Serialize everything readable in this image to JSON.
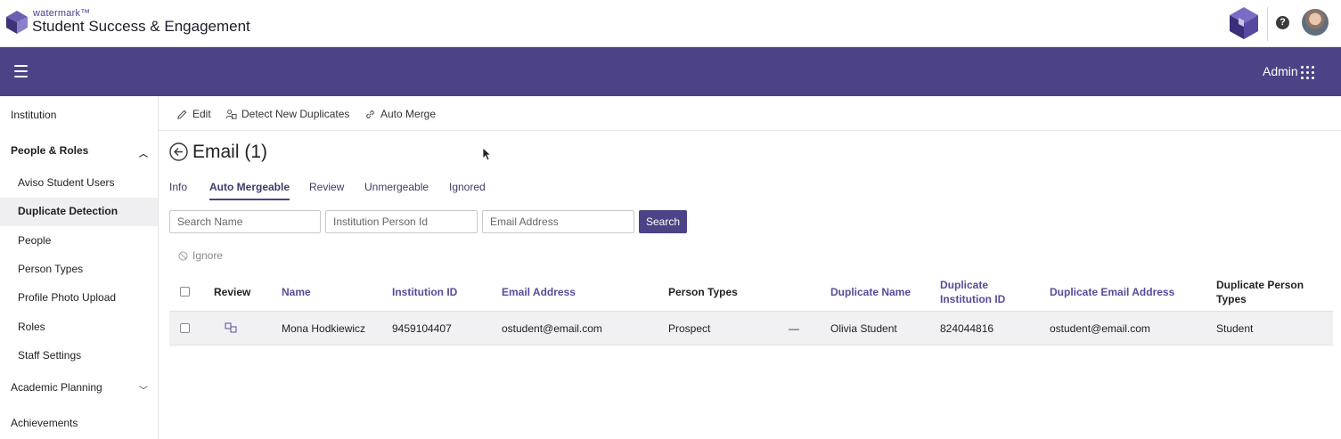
{
  "header": {
    "brand_small": "watermark™",
    "brand_name": "Student Success & Engagement",
    "help": "?"
  },
  "nav": {
    "admin_label": "Admin"
  },
  "sidebar": {
    "items": [
      {
        "label": "Institution"
      },
      {
        "label": "People & Roles"
      },
      {
        "label": "Aviso Student Users"
      },
      {
        "label": "Duplicate Detection"
      },
      {
        "label": "People"
      },
      {
        "label": "Person Types"
      },
      {
        "label": "Profile Photo Upload"
      },
      {
        "label": "Roles"
      },
      {
        "label": "Staff Settings"
      },
      {
        "label": "Academic Planning"
      },
      {
        "label": "Achievements"
      }
    ]
  },
  "toolbar": {
    "edit": "Edit",
    "detect": "Detect New Duplicates",
    "auto_merge": "Auto Merge"
  },
  "page": {
    "title": "Email (1)"
  },
  "tabs": [
    "Info",
    "Auto Mergeable",
    "Review",
    "Unmergeable",
    "Ignored"
  ],
  "search": {
    "name_placeholder": "Search Name",
    "id_placeholder": "Institution Person Id",
    "email_placeholder": "Email Address",
    "button": "Search"
  },
  "actions": {
    "ignore": "Ignore"
  },
  "table": {
    "headers": {
      "review": "Review",
      "name": "Name",
      "institution_id": "Institution ID",
      "email": "Email Address",
      "person_types": "Person Types",
      "dup_name": "Duplicate Name",
      "dup_id_1": "Duplicate",
      "dup_id_2": "Institution ID",
      "dup_email": "Duplicate Email Address",
      "dup_types_1": "Duplicate Person",
      "dup_types_2": "Types"
    },
    "rows": [
      {
        "name": "Mona Hodkiewicz",
        "institution_id": "9459104407",
        "email": "ostudent@email.com",
        "person_types": "Prospect",
        "dash": "—",
        "dup_name": "Olivia Student",
        "dup_id": "824044816",
        "dup_email": "ostudent@email.com",
        "dup_types": "Student"
      }
    ]
  },
  "colors": {
    "brand_purple": "#4b4386",
    "link_purple": "#5a4a9c"
  }
}
